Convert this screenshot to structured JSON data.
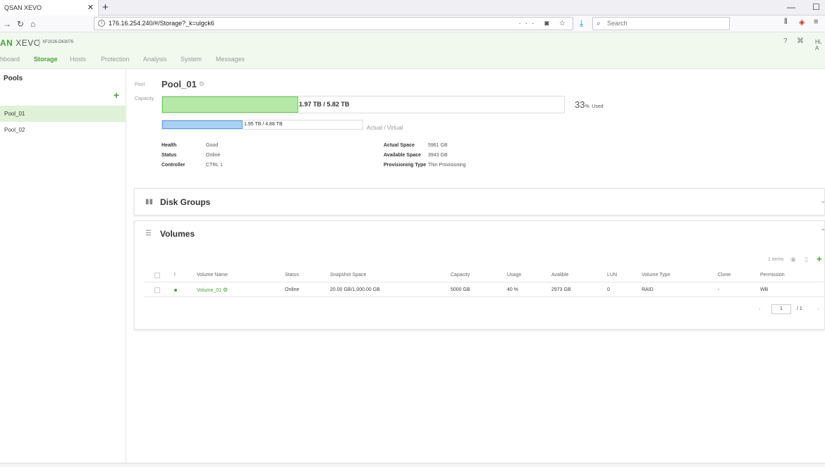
{
  "browser": {
    "tab_title": "QSAN XEVO",
    "tab_close": "✕",
    "new_tab": "+",
    "url": "176.16.254.240/#/Storage?_k=ulgck6",
    "url_actions": "··· ◙ ☆",
    "search_placeholder": "Search",
    "window_min": "—",
    "window_max": "☐"
  },
  "app": {
    "logo_prefix": "AN",
    "logo_suffix": "XEVO",
    "device_name": "XF2026-D63076",
    "greeting": "Hi, A",
    "nav": [
      {
        "label": "hboard"
      },
      {
        "label": "Storage"
      },
      {
        "label": "Hosts"
      },
      {
        "label": "Protection"
      },
      {
        "label": "Analysis"
      },
      {
        "label": "System"
      },
      {
        "label": "Messages"
      }
    ]
  },
  "sidebar": {
    "title": "Pools",
    "add": "+",
    "items": [
      {
        "label": "Pool_01"
      },
      {
        "label": "Pool_02"
      }
    ]
  },
  "pool": {
    "label_pool": "Pool",
    "name": "Pool_01",
    "label_capacity": "Capacity",
    "capacity_text": "1.97 TB / 5.82 TB",
    "capacity_fraction": 0.338,
    "used_pct": "33",
    "used_pct_suffix": "%",
    "used_label": "Used",
    "virtual_text": "1.95 TB / 4.88 TB",
    "virtual_fraction": 0.4,
    "virtual_label": "Actual / Virtual",
    "info_left": [
      {
        "label": "Health",
        "value": "Good"
      },
      {
        "label": "Status",
        "value": "Online"
      },
      {
        "label": "Controller",
        "value": "CTRL 1"
      }
    ],
    "info_right": [
      {
        "label": "Actual Space",
        "value": "5961 GB"
      },
      {
        "label": "Available Space",
        "value": "3943 GB"
      },
      {
        "label": "Provisioning Type",
        "value": "Thin Provisioning"
      }
    ]
  },
  "disk_groups": {
    "title": "Disk Groups"
  },
  "volumes": {
    "title": "Volumes",
    "items_count": "1 items",
    "add": "+",
    "columns": {
      "bang": "!",
      "name": "Volume Name",
      "status": "Status",
      "snapshot": "Snapshot Space",
      "capacity": "Capacity",
      "usage": "Usage",
      "available": "Avalible",
      "lun": "LUN",
      "type": "Volume Type",
      "clone": "Clone",
      "permission": "Permission"
    },
    "rows": [
      {
        "name": "Volume_01",
        "status": "Online",
        "snapshot": "20.00 GB/1,000.00 GB",
        "capacity": "5000 GB",
        "usage": "40 %",
        "available": "2973 GB",
        "lun": "0",
        "type": "RAID",
        "clone": "-",
        "permission": "WB"
      }
    ],
    "pager": {
      "page": "1",
      "total": "/ 1",
      "prev": "‹",
      "next": "›"
    }
  },
  "colors": {
    "accent": "#4aa03a",
    "capacity_fill": "#b6e8a8",
    "virtual_fill": "#a9d1f5"
  }
}
